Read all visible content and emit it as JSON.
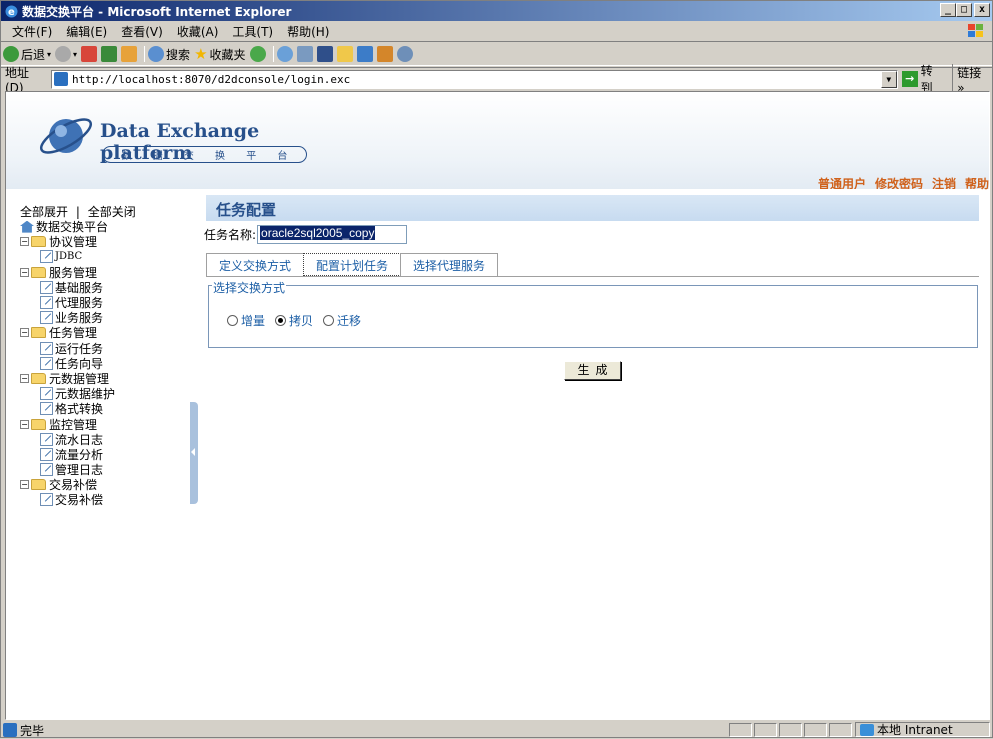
{
  "window": {
    "title": "数据交换平台 - Microsoft Internet Explorer",
    "min_label": "_",
    "max_label": "□",
    "close_label": "x"
  },
  "menu": [
    "文件(F)",
    "编辑(E)",
    "查看(V)",
    "收藏(A)",
    "工具(T)",
    "帮助(H)"
  ],
  "toolbar": {
    "back": "后退",
    "search": "搜索",
    "favorites": "收藏夹"
  },
  "address": {
    "label": "地址(D)",
    "url": "http://localhost:8070/d2dconsole/login.exc",
    "go": "转到",
    "links": "链接 »"
  },
  "header": {
    "logo_title": "Data Exchange platform",
    "logo_sub": [
      "数",
      "据",
      "交",
      "换",
      "平",
      "台"
    ],
    "user_links": [
      "普通用户",
      "修改密码",
      "注销",
      "帮助"
    ]
  },
  "tree": {
    "expand_all": "全部展开",
    "separator": "|",
    "collapse_all": "全部关闭",
    "root": "数据交换平台",
    "groups": [
      {
        "label": "协议管理",
        "items": [
          "JDBC"
        ]
      },
      {
        "label": "服务管理",
        "items": [
          "基础服务",
          "代理服务",
          "业务服务"
        ]
      },
      {
        "label": "任务管理",
        "items": [
          "运行任务",
          "任务向导"
        ]
      },
      {
        "label": "元数据管理",
        "items": [
          "元数据维护",
          "格式转换"
        ]
      },
      {
        "label": "监控管理",
        "items": [
          "流水日志",
          "流量分析",
          "管理日志"
        ]
      },
      {
        "label": "交易补偿",
        "items": [
          "交易补偿"
        ]
      }
    ]
  },
  "main": {
    "title": "任务配置",
    "task_name_label": "任务名称:",
    "task_name_value": "oracle2sql2005_copy",
    "tabs": [
      "定义交换方式",
      "配置计划任务",
      "选择代理服务"
    ],
    "active_tab": 1,
    "fieldset_legend": "选择交换方式",
    "radios": [
      {
        "label": "增量",
        "checked": false
      },
      {
        "label": "拷贝",
        "checked": true
      },
      {
        "label": "迁移",
        "checked": false
      }
    ],
    "generate_button": "生成"
  },
  "status": {
    "text": "完毕",
    "zone": "本地 Intranet"
  },
  "colors": {
    "title_bar": "#0a246a",
    "accent_blue": "#27508b",
    "link_orange": "#d0621c",
    "panel_header": "#c7dbf0"
  }
}
